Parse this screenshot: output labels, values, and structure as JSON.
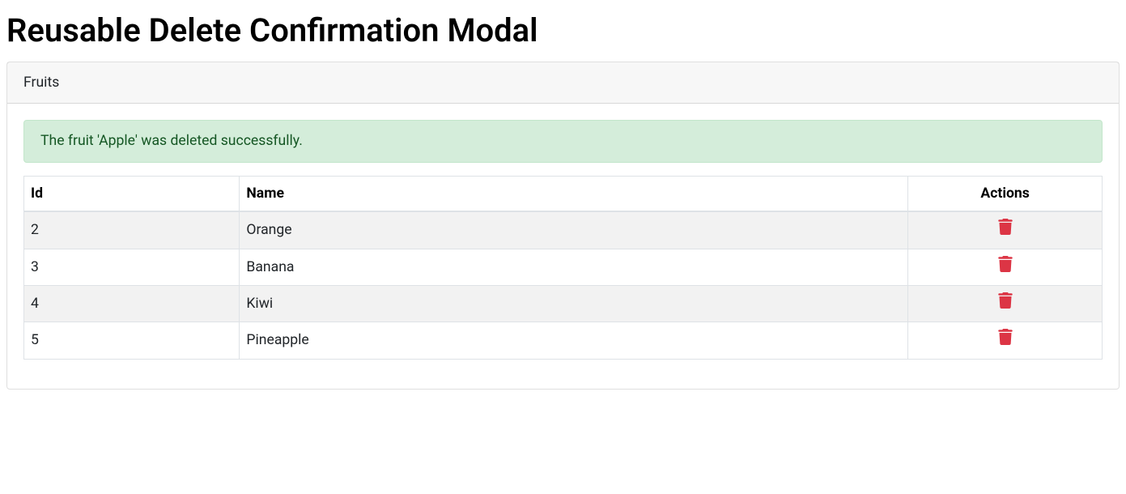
{
  "page": {
    "title": "Reusable Delete Confirmation Modal"
  },
  "card": {
    "header": "Fruits"
  },
  "alert": {
    "message": "The fruit 'Apple' was deleted successfully."
  },
  "table": {
    "headers": {
      "id": "Id",
      "name": "Name",
      "actions": "Actions"
    },
    "rows": [
      {
        "id": "2",
        "name": "Orange"
      },
      {
        "id": "3",
        "name": "Banana"
      },
      {
        "id": "4",
        "name": "Kiwi"
      },
      {
        "id": "5",
        "name": "Pineapple"
      }
    ]
  }
}
